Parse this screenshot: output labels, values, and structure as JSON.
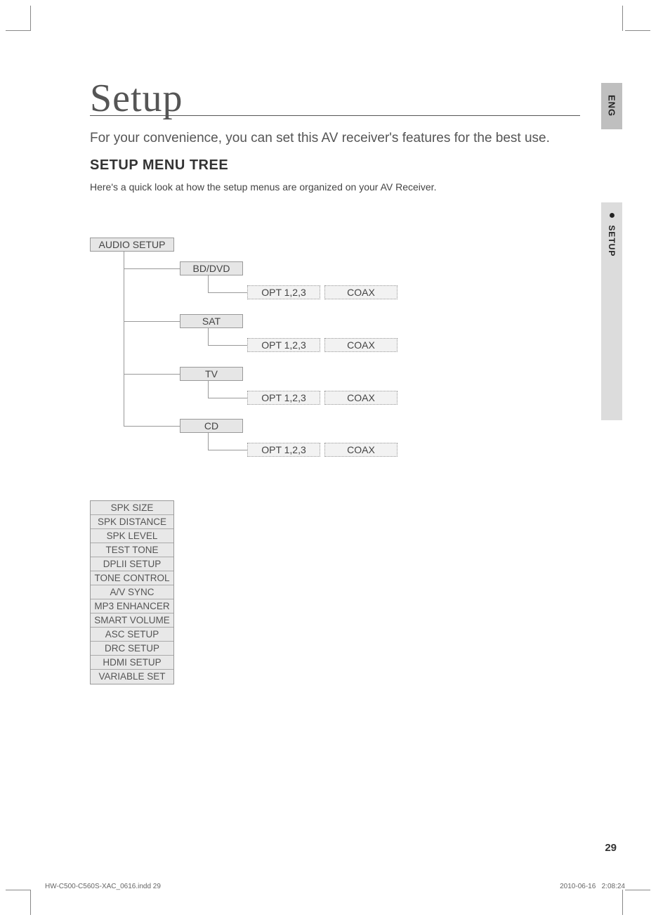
{
  "header": {
    "title": "Setup",
    "intro": "For your convenience, you can set this AV receiver's features for the best use.",
    "section_title": "SETUP MENU TREE",
    "section_sub": "Here's a quick look at how the setup menus are organized on your AV Receiver."
  },
  "side": {
    "lang": "ENG",
    "section": "SETUP"
  },
  "tree": {
    "root": "AUDIO SETUP",
    "sources": [
      {
        "name": "BD/DVD",
        "opts": [
          "OPT 1,2,3",
          "COAX"
        ]
      },
      {
        "name": "SAT",
        "opts": [
          "OPT 1,2,3",
          "COAX"
        ]
      },
      {
        "name": "TV",
        "opts": [
          "OPT 1,2,3",
          "COAX"
        ]
      },
      {
        "name": "CD",
        "opts": [
          "OPT 1,2,3",
          "COAX"
        ]
      }
    ],
    "items": [
      "SPK SIZE",
      "SPK DISTANCE",
      "SPK LEVEL",
      "TEST TONE",
      "DPLII SETUP",
      "TONE CONTROL",
      "A/V SYNC",
      "MP3 ENHANCER",
      "SMART VOLUME",
      "ASC SETUP",
      "DRC SETUP",
      "HDMI SETUP",
      "VARIABLE SET"
    ]
  },
  "footer": {
    "page": "29",
    "left": "HW-C500-C560S-XAC_0616.indd   29",
    "date": "2010-06-16",
    "time": "2:08:24"
  }
}
